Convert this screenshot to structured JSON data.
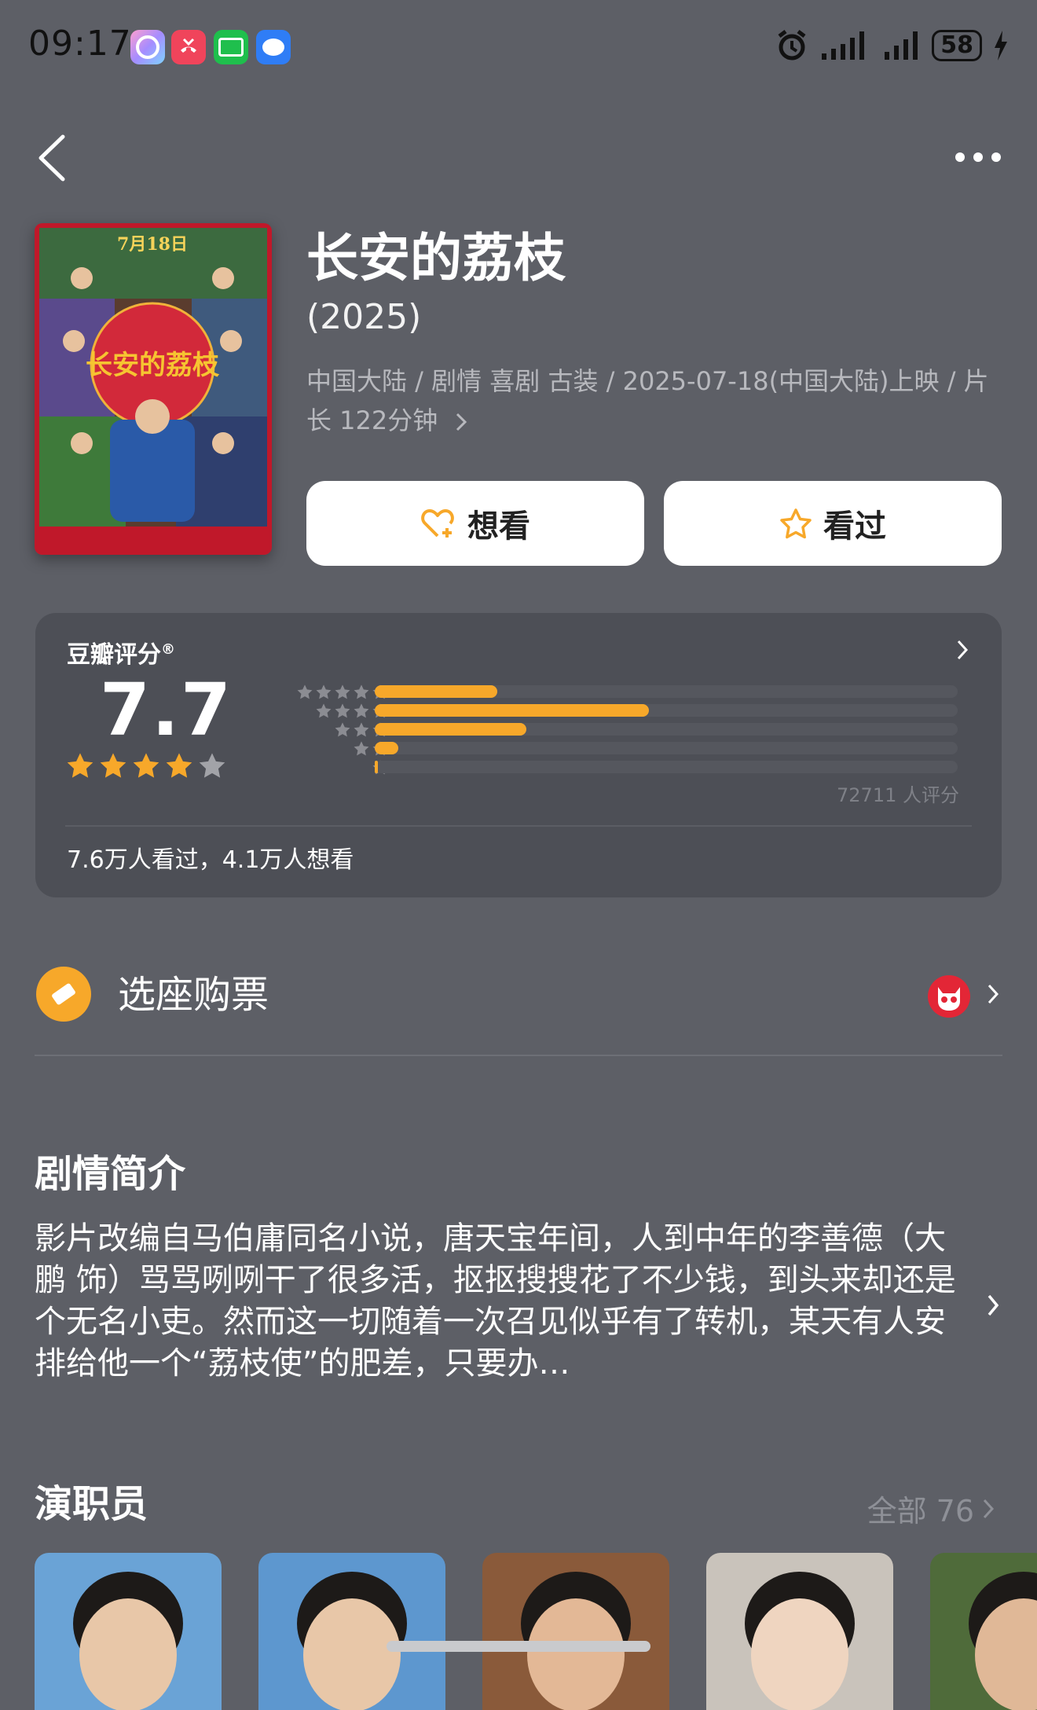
{
  "status_bar": {
    "time": "09:17",
    "battery": "58"
  },
  "movie": {
    "title": "长安的荔枝",
    "year": "(2025)",
    "meta": "中国大陆 / 剧情 喜剧 古装 / 2025-07-18(中国大陆)上映 / 片长 122分钟",
    "poster_text_1": "7月18日",
    "poster_text_2": "长安的荔枝"
  },
  "actions": {
    "want_label": "想看",
    "seen_label": "看过"
  },
  "rating": {
    "label": "豆瓣评分",
    "label_mark": "®",
    "score": "7.7",
    "stars_filled": 4,
    "rating_count": "72711 人评分",
    "distribution": [
      {
        "stars": 5,
        "fraction": 0.21
      },
      {
        "stars": 4,
        "fraction": 0.47
      },
      {
        "stars": 3,
        "fraction": 0.26
      },
      {
        "stars": 2,
        "fraction": 0.04
      },
      {
        "stars": 1,
        "fraction": 0.005
      }
    ],
    "footer": "7.6万人看过，4.1万人想看"
  },
  "tickets": {
    "label": "选座购票"
  },
  "synopsis": {
    "title": "剧情简介",
    "text": "影片改编自马伯庸同名小说，唐天宝年间，人到中年的李善德（大鹏 饰）骂骂咧咧干了很多活，抠抠搜搜花了不少钱，到头来却还是个无名小吏。然而这一切随着一次召见似乎有了转机，某天有人安排给他一个“荔枝使”的肥差，只要办…"
  },
  "cast": {
    "title": "演职员",
    "all_label": "全部 76",
    "members": [
      {
        "bg": "#6aa3d6",
        "skin": "#e8c7a8"
      },
      {
        "bg": "#5d97cf",
        "skin": "#e8c7a8"
      },
      {
        "bg": "#8a5a3a",
        "skin": "#e3b896"
      },
      {
        "bg": "#c9c3bb",
        "skin": "#efd5c0"
      },
      {
        "bg": "#4f6b3a",
        "skin": "#e0b897"
      }
    ]
  },
  "colors": {
    "background": "#5d5f66",
    "card": "#4d4f56",
    "accent": "#f7a82a"
  }
}
